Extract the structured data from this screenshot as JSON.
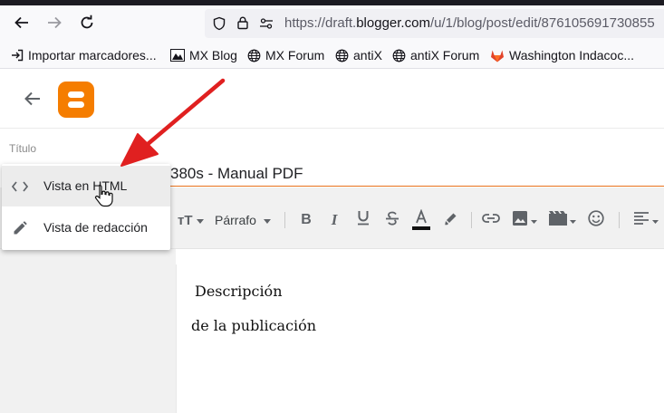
{
  "browser": {
    "url_scheme": "https://",
    "url_host_pre": "draft.",
    "url_host_domain": "blogger.com",
    "url_path": "/u/1/blog/post/edit/876105691730855"
  },
  "bookmarks": [
    {
      "label": "Importar marcadores...",
      "icon": "import-icon"
    },
    {
      "label": "MX Blog",
      "icon": "mx-icon"
    },
    {
      "label": "MX Forum",
      "icon": "globe-icon"
    },
    {
      "label": "antiX",
      "icon": "globe-icon"
    },
    {
      "label": "antiX Forum",
      "icon": "globe-icon"
    },
    {
      "label": "Washington Indacoc...",
      "icon": "gitlab-icon"
    }
  ],
  "editor": {
    "title_label": "Título",
    "post_title": "380s - Manual PDF",
    "paragraph_style": "Párrafo",
    "body_lines": [
      "Descripción",
      "de la publicación"
    ]
  },
  "view_menu": {
    "items": [
      {
        "label": "Vista en HTML",
        "icon": "code-icon"
      },
      {
        "label": "Vista de redacción",
        "icon": "pencil-icon"
      }
    ]
  },
  "colors": {
    "blogger_orange": "#f57d00",
    "accent_underline": "#e8711c",
    "annotation_arrow": "#e02020"
  }
}
